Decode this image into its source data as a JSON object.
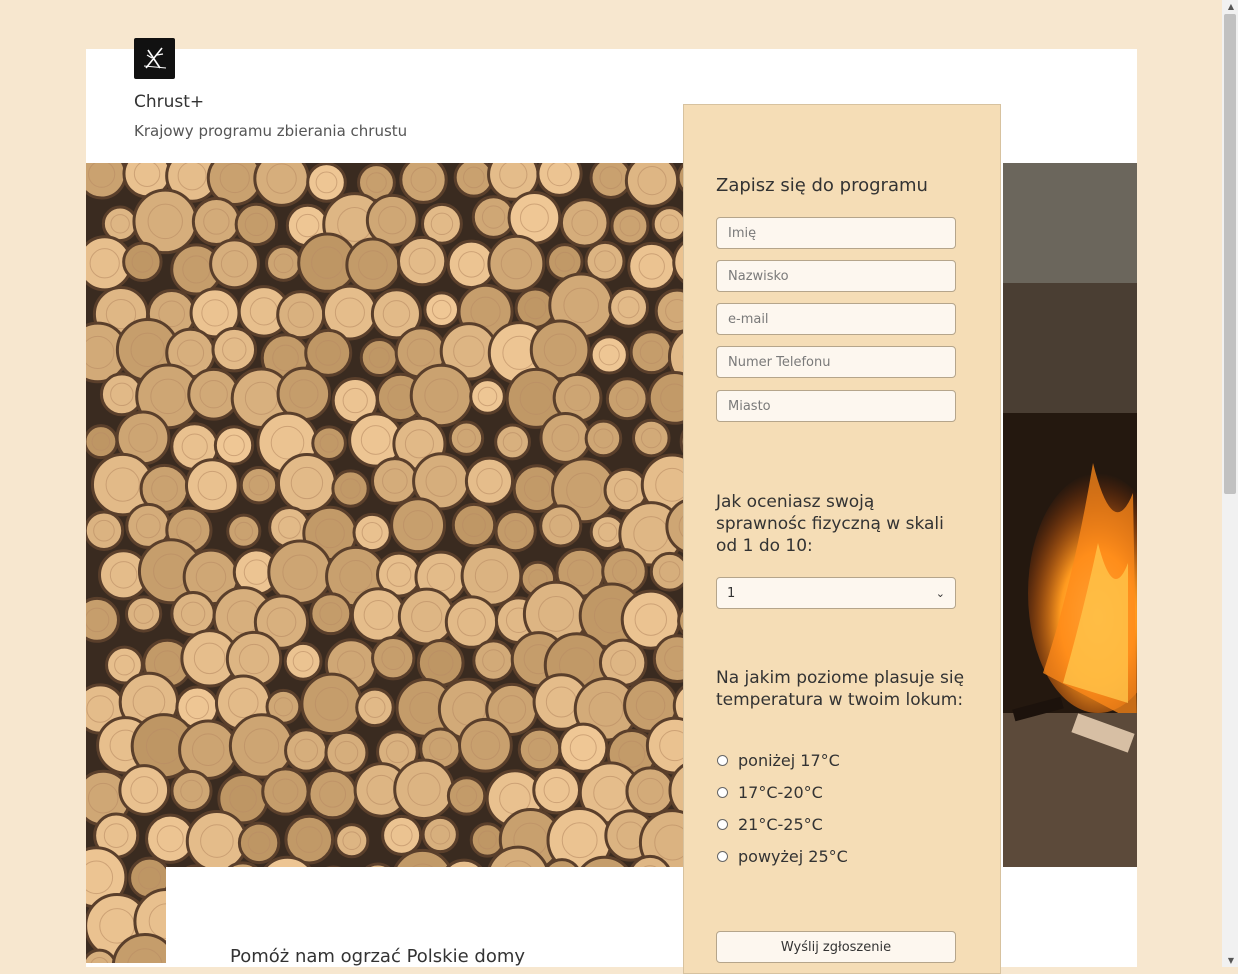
{
  "header": {
    "brand": "Chrust+",
    "tagline": "Krajowy programu zbierania chrustu",
    "logo_icon": "crossed-sticks-icon"
  },
  "form": {
    "title": "Zapisz się do programu",
    "fields": {
      "first_name_placeholder": "Imię",
      "last_name_placeholder": "Nazwisko",
      "email_placeholder": "e-mail",
      "phone_placeholder": "Numer Telefonu",
      "city_placeholder": "Miasto"
    },
    "fitness_question": "Jak oceniasz swoją sprawnośc fizyczną w skali od 1 do 10:",
    "fitness_selected": "1",
    "temperature_question": "Na jakim poziome plasuje się temperatura w twoim lokum:",
    "temperature_options": [
      "poniżej 17°C",
      "17°C-20°C",
      "21°C-25°C",
      "powyżej 25°C"
    ],
    "submit_label": "Wyślij zgłoszenie"
  },
  "content": {
    "help_title": "Pomóż nam ogrzać Polskie domy"
  },
  "colors": {
    "background": "#f7e7cf",
    "form_panel": "#f5ddb6",
    "input_bg": "#fdf7ef"
  }
}
